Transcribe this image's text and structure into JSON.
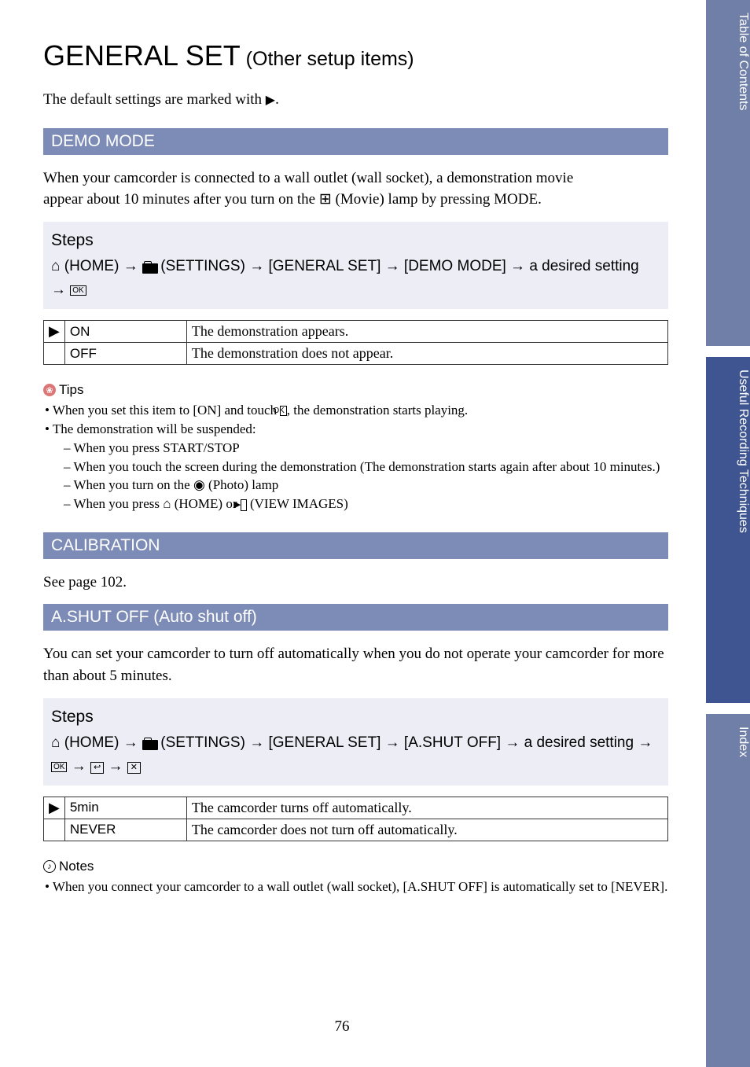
{
  "title": {
    "big": "GENERAL SET",
    "sub": " (Other setup items)"
  },
  "intro_pre": "The default settings are marked with ",
  "intro_post": ".",
  "sections": {
    "demo": {
      "bar": "DEMO MODE",
      "desc_line1": "When your camcorder is connected to a wall outlet (wall socket), a demonstration movie",
      "desc_line2_pre": "appear about 10 minutes after you turn on the ",
      "desc_line2_post": " (Movie) lamp by pressing MODE.",
      "steps_title": "Steps",
      "steps_line1_pre": " (HOME) → ",
      "steps_line1_mid": " (SETTINGS) → [GENERAL SET] → [DEMO MODE] → a desired setting",
      "steps_line2_pre": "→ ",
      "options": [
        {
          "mark": "▶",
          "name": "ON",
          "desc": "The demonstration appears."
        },
        {
          "mark": "",
          "name": "OFF",
          "desc": "The demonstration does not appear."
        }
      ],
      "tips_label": "Tips",
      "tips": {
        "t1_pre": "When you set this item to [ON] and touch ",
        "t1_post": ", the demonstration starts playing.",
        "t2": "The demonstration will be suspended:",
        "t2a": "When you press START/STOP",
        "t2b": "When you touch the screen during the demonstration (The demonstration starts again after about 10 minutes.)",
        "t2c_pre": "When you turn on the ",
        "t2c_post": " (Photo) lamp",
        "t2d_pre": "When you press ",
        "t2d_mid": " (HOME) or ",
        "t2d_post": " (VIEW IMAGES)"
      }
    },
    "cal": {
      "bar": "CALIBRATION",
      "desc": "See page 102."
    },
    "ashut": {
      "bar": "A.SHUT OFF (Auto shut off)",
      "desc": "You can set your camcorder to turn off automatically when you do not operate your camcorder for more than about 5 minutes.",
      "steps_title": "Steps",
      "steps_line1_pre": " (HOME) → ",
      "steps_line1_mid": " (SETTINGS) → [GENERAL SET] → [A.SHUT OFF] → a desired setting → ",
      "options": [
        {
          "mark": "▶",
          "name": "5min",
          "desc": "The camcorder turns off automatically."
        },
        {
          "mark": "",
          "name": "NEVER",
          "desc": "The camcorder does not turn off automatically."
        }
      ],
      "notes_label": "Notes",
      "note1": "When you connect your camcorder to a wall outlet (wall socket), [A.SHUT OFF] is automatically set to [NEVER]."
    }
  },
  "glyphs": {
    "home": "⌂",
    "movie": "⊞",
    "ok": "OK",
    "back": "↩",
    "close": "✕",
    "play": "▶",
    "camera": "◉",
    "triangle": "▶"
  },
  "page_number": "76",
  "side_tabs": {
    "toc": "Table of Contents",
    "tech": "Useful Recording Techniques",
    "index": "Index"
  }
}
